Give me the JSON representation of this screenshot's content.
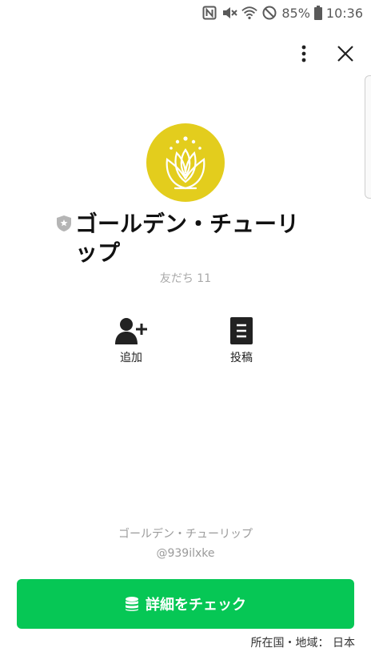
{
  "status_bar": {
    "battery_percent": "85%",
    "time": "10:36",
    "icons": [
      "nfc-icon",
      "mute-icon",
      "wifi-icon",
      "do-not-disturb-icon",
      "battery-icon"
    ]
  },
  "header": {
    "more_icon": "more-vertical-icon",
    "close_icon": "close-icon"
  },
  "profile": {
    "avatar_icon": "tulip-logo",
    "avatar_color": "#e3cd1d",
    "badge_icon": "verified-shield-icon",
    "name": "ゴールデン・チューリップ",
    "friends_label": "友だち 11"
  },
  "actions": [
    {
      "icon": "add-friend-icon",
      "label": "追加"
    },
    {
      "icon": "post-icon",
      "label": "投稿"
    }
  ],
  "footer": {
    "account_name": "ゴールデン・チューリップ",
    "account_id": "@939ilxke",
    "cta_label": "詳細をチェック",
    "cta_icon": "coins-icon",
    "cta_color": "#06c755",
    "country": "所在国・地域： 日本"
  }
}
